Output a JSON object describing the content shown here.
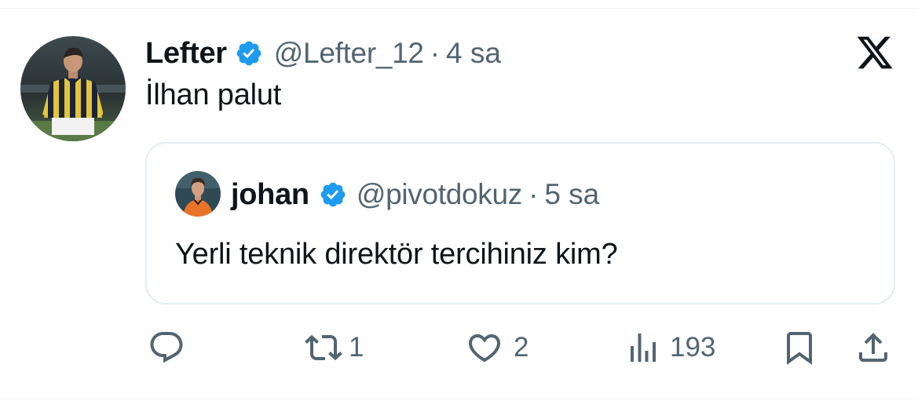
{
  "tweet": {
    "author": {
      "name": "Lefter",
      "handle": "@Lefter_12",
      "verified": true,
      "avatar_icon": "profile-photo-footballer-yellow-navy-stripes"
    },
    "separator": "·",
    "time": "4 sa",
    "text": "İlhan palut",
    "platform_icon": "x-logo-icon"
  },
  "quote": {
    "author": {
      "name": "johan",
      "handle": "@pivotdokuz",
      "verified": true,
      "avatar_icon": "profile-photo-orange-jersey"
    },
    "separator": "·",
    "time": "5 sa",
    "text": "Yerli teknik direktör tercihiniz kim?"
  },
  "actions": {
    "reply": {
      "icon": "reply-icon",
      "count": ""
    },
    "retweet": {
      "icon": "retweet-icon",
      "count": "1"
    },
    "like": {
      "icon": "heart-icon",
      "count": "2"
    },
    "views": {
      "icon": "views-icon",
      "count": "193"
    },
    "bookmark": {
      "icon": "bookmark-icon"
    },
    "share": {
      "icon": "share-icon"
    }
  },
  "colors": {
    "text_primary": "#0f1419",
    "text_secondary": "#536471",
    "verified_blue": "#1d9bf0",
    "border": "#e6ecf0"
  }
}
